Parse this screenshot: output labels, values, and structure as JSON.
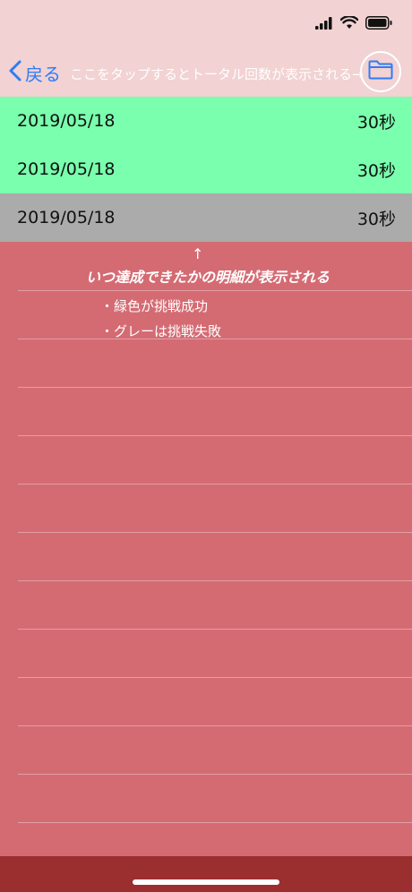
{
  "nav": {
    "back_label": "戻る",
    "hint_text": "ここをタップするとトータル回数が表示される→"
  },
  "records": [
    {
      "date": "2019/05/18",
      "duration": "30秒",
      "status": "success"
    },
    {
      "date": "2019/05/18",
      "duration": "30秒",
      "status": "success"
    },
    {
      "date": "2019/05/18",
      "duration": "30秒",
      "status": "failure"
    }
  ],
  "annotation": {
    "arrow": "↑",
    "title": "いつ達成できたかの明細が表示される",
    "legend": [
      "・緑色が挑戦成功",
      "・グレーは挑戦失敗"
    ]
  },
  "colors": {
    "success": "#7AFFAE",
    "failure": "#ABABAB",
    "background": "#D46B73",
    "navbar": "#F2D2D2",
    "accent": "#2F7CF6",
    "bottom_bar": "#9B2E2F"
  }
}
